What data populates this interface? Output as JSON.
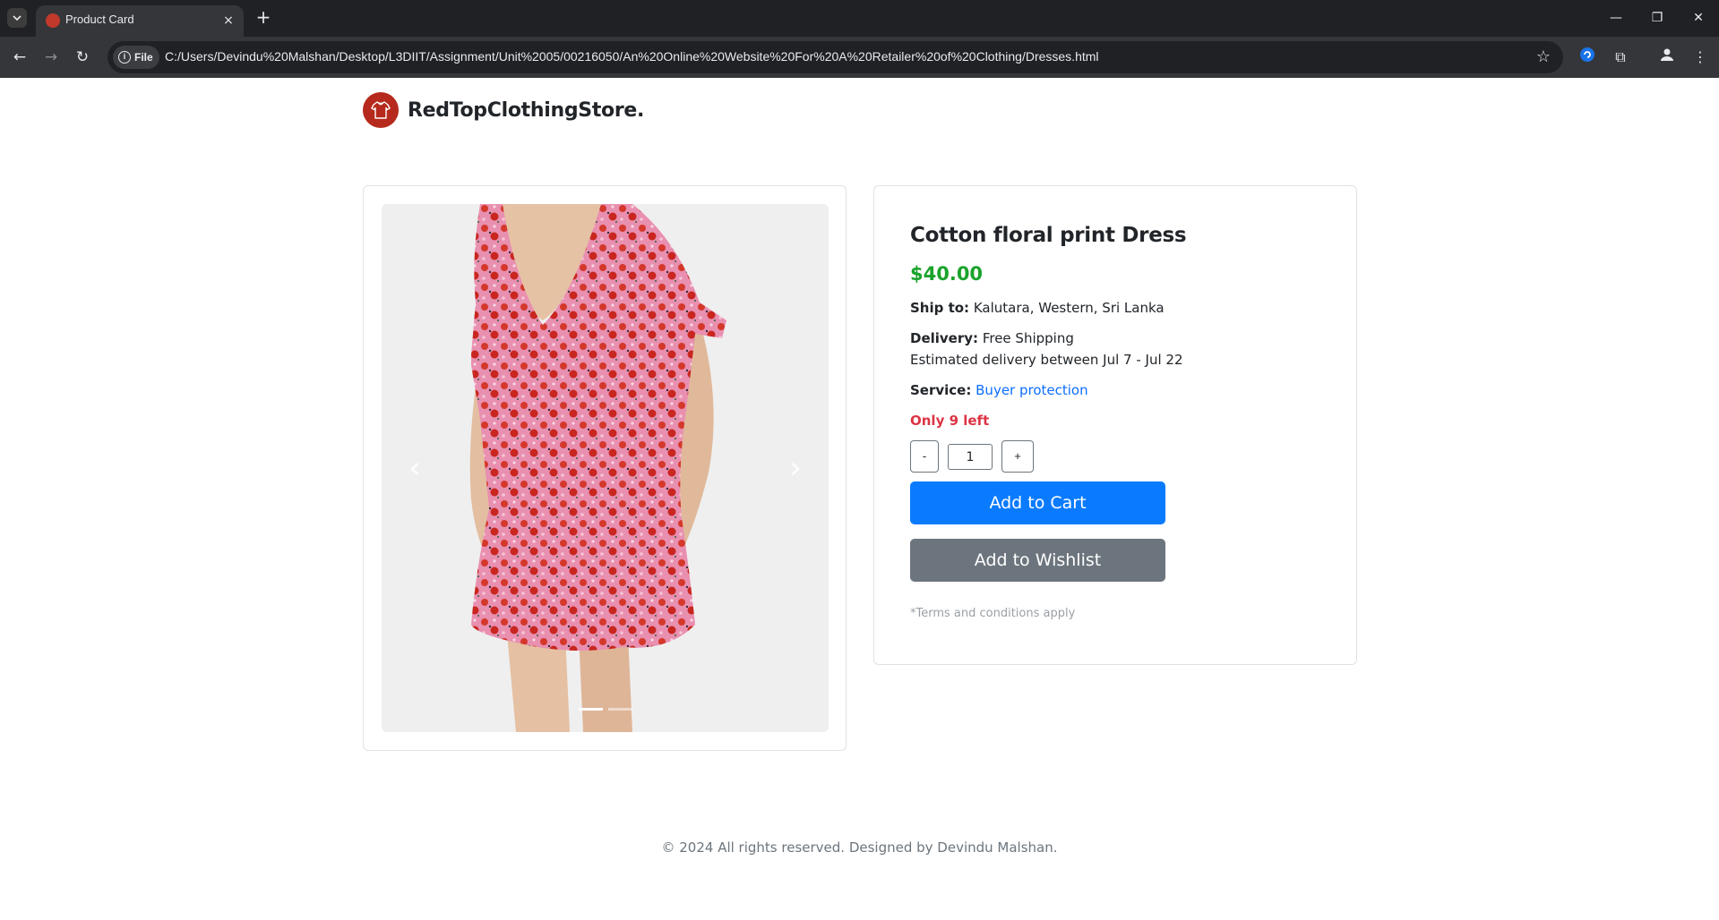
{
  "browser": {
    "tab_title": "Product Card",
    "tab_close": "×",
    "new_tab": "+",
    "site_chip": "File",
    "url": "C:/Users/Devindu%20Malshan/Desktop/L3DIIT/Assignment/Unit%2005/00216050/An%20Online%20Website%20For%20A%20Retailer%20of%20Clothing/Dresses.html"
  },
  "brand": {
    "name": "RedTopClothingStore.",
    "color": "#b52a1c"
  },
  "carousel": {
    "slide_count": 2,
    "active_index": 0
  },
  "product": {
    "title": "Cotton floral print Dress",
    "price": "$40.00",
    "ship_label": "Ship to:",
    "ship_value": "Kalutara, Western, Sri Lanka",
    "delivery_label": "Delivery:",
    "delivery_value": "Free Shipping",
    "delivery_estimate": "Estimated delivery between Jul 7 - Jul 22",
    "service_label": "Service:",
    "service_value": "Buyer protection",
    "stock": "Only 9 left",
    "quantity": "1",
    "minus_label": "-",
    "plus_label": "+",
    "add_to_cart": "Add to Cart",
    "add_to_wishlist": "Add to Wishlist",
    "terms": "*Terms and conditions apply"
  },
  "colors": {
    "price": "#1aa32b",
    "stock": "#dc3545",
    "cart_button": "#0a7bff",
    "wishlist_button": "#6c757d",
    "link": "#0d6efd"
  },
  "footer": {
    "text": "© 2024 All rights reserved. Designed by Devindu Malshan."
  }
}
